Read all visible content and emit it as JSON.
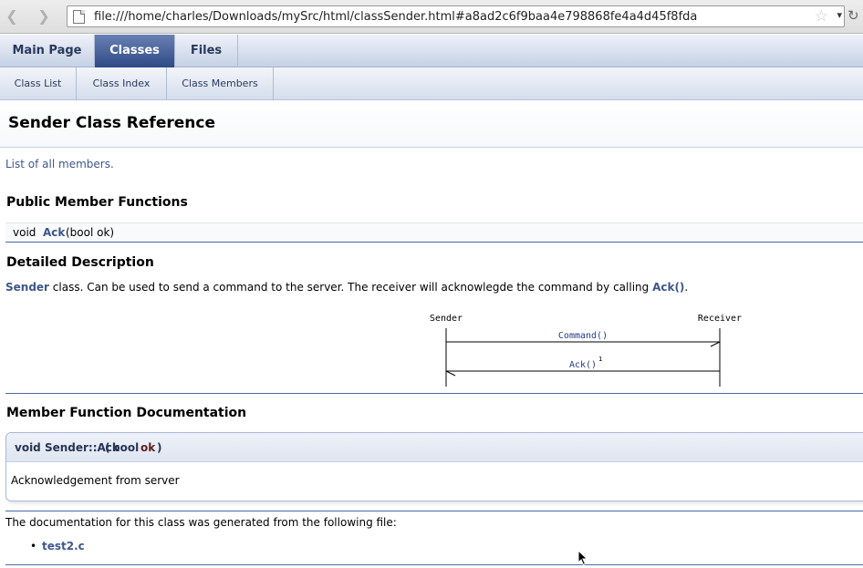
{
  "browser": {
    "url": "file:///home/charles/Downloads/mySrc/html/classSender.html#a8ad2c6f9baa4e798868fe4a4d45f8fda",
    "back_icon": "back-arrow-icon",
    "forward_icon": "forward-arrow-icon",
    "star_icon": "star-icon",
    "reload_icon": "reload-icon"
  },
  "tabs": [
    {
      "label": "Main Page",
      "current": false
    },
    {
      "label": "Classes",
      "current": true
    },
    {
      "label": "Files",
      "current": false
    }
  ],
  "subtabs": [
    {
      "label": "Class List"
    },
    {
      "label": "Class Index"
    },
    {
      "label": "Class Members"
    }
  ],
  "header": {
    "title": "Sender Class Reference"
  },
  "summary_link": "List of all members.",
  "public_functions": {
    "heading": "Public Member Functions",
    "members": [
      {
        "type": "void",
        "name": "Ack",
        "args": "(bool ok)"
      }
    ]
  },
  "detailed": {
    "heading": "Detailed Description",
    "class_link": "Sender",
    "text": " class. Can be used to send a command to the server. The receiver will acknowlegde the command by calling ",
    "ack_link": "Ack()",
    "end": "."
  },
  "msc": {
    "entities": [
      "Sender",
      "Receiver"
    ],
    "messages": [
      {
        "label": "Command()",
        "from": "Sender",
        "to": "Receiver",
        "superscript": ""
      },
      {
        "label": "Ack()",
        "from": "Receiver",
        "to": "Sender",
        "superscript": "1"
      }
    ]
  },
  "member_doc": {
    "heading": "Member Function Documentation",
    "proto_name": "void Sender::Ack",
    "paren_open": "(",
    "param_type": "bool",
    "param_name": "ok",
    "paren_close": ")",
    "doc": "Acknowledgement from server"
  },
  "footer": {
    "text": "The documentation for this class was generated from the following file:",
    "files": [
      "test2.c"
    ]
  },
  "colors": {
    "link": "#3d578c",
    "tab_active": "#2e4a85",
    "separator": "#4a6aa5",
    "param": "#602020"
  }
}
